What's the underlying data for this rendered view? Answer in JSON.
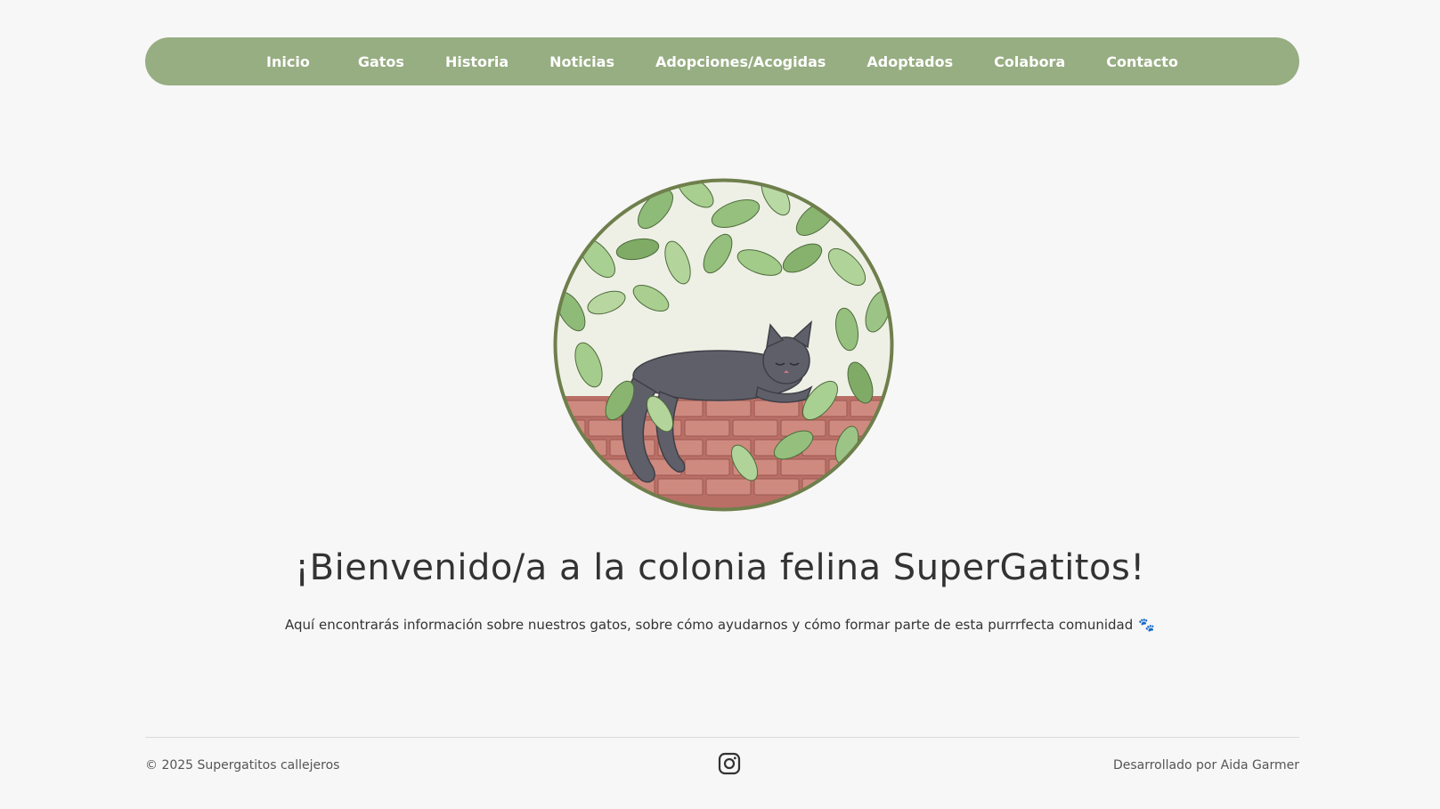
{
  "nav": {
    "items": [
      {
        "label": "Inicio"
      },
      {
        "label": "Gatos"
      },
      {
        "label": "Historia"
      },
      {
        "label": "Noticias"
      },
      {
        "label": "Adopciones/Acogidas"
      },
      {
        "label": "Adoptados"
      },
      {
        "label": "Colabora"
      },
      {
        "label": "Contacto"
      }
    ]
  },
  "hero": {
    "image_icon": "sleeping-cat-illustration"
  },
  "main": {
    "title": "¡Bienvenido/a a la colonia felina SuperGatitos!",
    "subtitle": "Aquí encontrarás información sobre nuestros gatos, sobre cómo ayudarnos y cómo formar parte de esta purrrfecta comunidad",
    "subtitle_emoji": "🐾"
  },
  "footer": {
    "copyright": "© 2025 Supergatitos callejeros",
    "social_icon": "instagram-icon",
    "credit": "Desarrollado por Aida Garmer"
  },
  "colors": {
    "nav_bg": "#97ad82",
    "page_bg": "#f7f7f7",
    "text": "#333333"
  }
}
